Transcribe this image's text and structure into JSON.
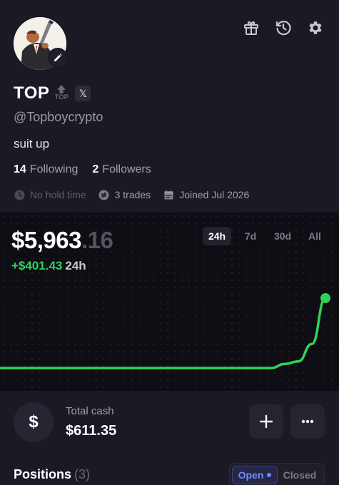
{
  "profile": {
    "name": "TOP",
    "token_badge": "TOP",
    "handle": "@Topboycrypto",
    "bio": "suit up",
    "following_count": "14",
    "following_label": "Following",
    "followers_count": "2",
    "followers_label": "Followers",
    "hold_time": "No hold time",
    "trades": "3 trades",
    "joined": "Joined Jul 2026"
  },
  "header_icons": [
    "gift-icon",
    "history-icon",
    "gear-icon"
  ],
  "portfolio": {
    "balance_main": "$5,963",
    "balance_cents": ".16",
    "change_value": "+$401.43",
    "change_period": "24h",
    "ranges": [
      "24h",
      "7d",
      "30d",
      "All"
    ],
    "active_range": "24h"
  },
  "chart_data": {
    "type": "line",
    "title": "",
    "xlabel": "",
    "ylabel": "",
    "grid": false,
    "color": "#2fd35a",
    "x": [
      0,
      1,
      2,
      3,
      4,
      5,
      6,
      7,
      8,
      9,
      10,
      11,
      12,
      13,
      14,
      15,
      16,
      17,
      18,
      19,
      20,
      21,
      22,
      23,
      24
    ],
    "values": [
      5561.73,
      5561.73,
      5561.73,
      5561.73,
      5561.73,
      5561.73,
      5561.73,
      5561.73,
      5561.73,
      5561.73,
      5561.73,
      5561.73,
      5561.73,
      5561.73,
      5561.73,
      5561.73,
      5561.73,
      5561.73,
      5561.73,
      5561.73,
      5561.73,
      5585,
      5600,
      5700,
      5963.16
    ]
  },
  "cash": {
    "label": "Total cash",
    "value": "$611.35",
    "currency_symbol": "$"
  },
  "positions": {
    "title": "Positions",
    "count": "(3)",
    "tabs": [
      "Open",
      "Closed"
    ],
    "active_tab": "Open"
  },
  "colors": {
    "accent_green": "#2fd35a",
    "accent_blue": "#6b8cff",
    "background": "#16151f"
  }
}
